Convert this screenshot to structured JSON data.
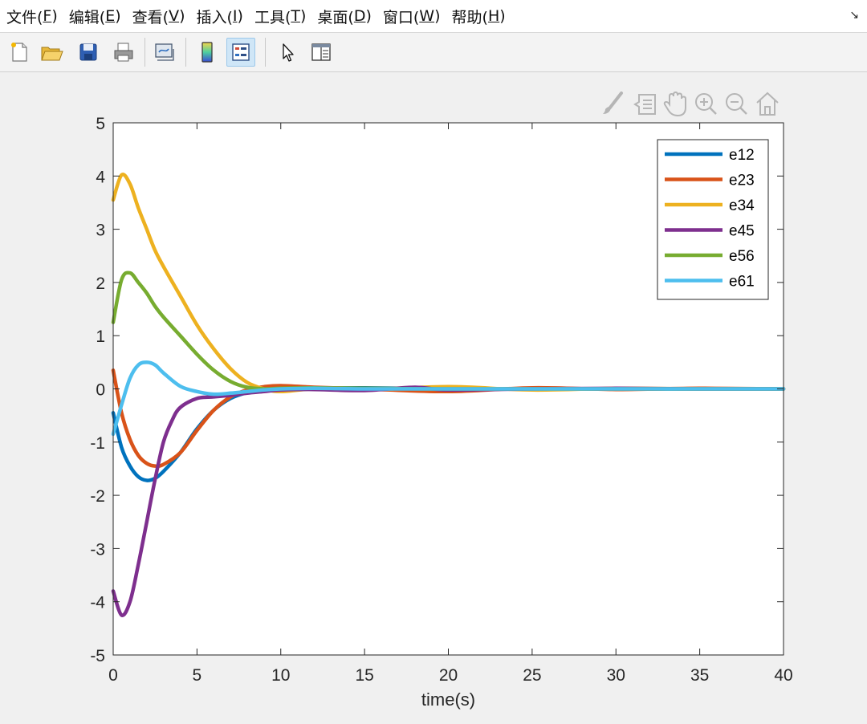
{
  "menubar": {
    "items": [
      {
        "text": "文件(",
        "mnemonic": "F",
        "close": ")"
      },
      {
        "text": "编辑(",
        "mnemonic": "E",
        "close": ")"
      },
      {
        "text": "查看(",
        "mnemonic": "V",
        "close": ")"
      },
      {
        "text": "插入(",
        "mnemonic": "I",
        "close": ")"
      },
      {
        "text": "工具(",
        "mnemonic": "T",
        "close": ")"
      },
      {
        "text": "桌面(",
        "mnemonic": "D",
        "close": ")"
      },
      {
        "text": "窗口(",
        "mnemonic": "W",
        "close": ")"
      },
      {
        "text": "帮助(",
        "mnemonic": "H",
        "close": ")"
      }
    ],
    "overflow_icon": "dock-arrow-icon"
  },
  "toolbar": {
    "buttons": [
      {
        "name": "new-figure-icon"
      },
      {
        "name": "open-file-icon"
      },
      {
        "name": "save-icon"
      },
      {
        "name": "print-icon"
      },
      {
        "name": "link-plot-icon"
      },
      {
        "name": "insert-colorbar-icon"
      },
      {
        "name": "insert-legend-icon",
        "active": true
      },
      {
        "name": "edit-plot-icon"
      },
      {
        "name": "property-inspector-icon"
      }
    ]
  },
  "axes_toolbar": {
    "icons": [
      "brush-icon",
      "data-tips-icon",
      "pan-icon",
      "zoom-in-icon",
      "zoom-out-icon",
      "restore-view-icon"
    ]
  },
  "colors": {
    "e12": "#0072BD",
    "e23": "#D95319",
    "e34": "#EDB120",
    "e45": "#7E2F8E",
    "e56": "#77AC30",
    "e61": "#4DBEEE"
  },
  "chart_data": {
    "type": "line",
    "title": "",
    "xlabel": "time(s)",
    "ylabel": "",
    "xlim": [
      0,
      40
    ],
    "ylim": [
      -5,
      5
    ],
    "xticks": [
      0,
      5,
      10,
      15,
      20,
      25,
      30,
      35,
      40
    ],
    "yticks": [
      5,
      4,
      3,
      2,
      1,
      0,
      -1,
      -2,
      -3,
      -4,
      -5
    ],
    "grid": false,
    "legend_position": "top-right",
    "series": [
      {
        "name": "e12",
        "color": "#0072BD",
        "x": [
          0,
          0.5,
          1,
          1.5,
          2,
          2.5,
          3,
          4,
          5,
          6,
          7,
          8,
          9,
          10,
          12,
          15,
          20,
          25,
          30,
          35,
          40
        ],
        "y": [
          -0.45,
          -1.1,
          -1.45,
          -1.65,
          -1.72,
          -1.68,
          -1.55,
          -1.2,
          -0.75,
          -0.4,
          -0.18,
          -0.07,
          -0.02,
          0.0,
          0.01,
          0.02,
          0.0,
          0.0,
          0.0,
          0.0,
          0.0
        ]
      },
      {
        "name": "e23",
        "color": "#D95319",
        "x": [
          0,
          0.5,
          1,
          1.5,
          2,
          2.5,
          3,
          4,
          5,
          6,
          7,
          8,
          9,
          10,
          12,
          15,
          20,
          25,
          30,
          35,
          40
        ],
        "y": [
          0.35,
          -0.45,
          -0.95,
          -1.25,
          -1.4,
          -1.45,
          -1.42,
          -1.2,
          -0.78,
          -0.4,
          -0.15,
          -0.02,
          0.04,
          0.06,
          0.03,
          0.0,
          -0.05,
          0.02,
          -0.01,
          0.01,
          0.0
        ]
      },
      {
        "name": "e34",
        "color": "#EDB120",
        "x": [
          0,
          0.5,
          1,
          1.5,
          2,
          2.5,
          3,
          4,
          5,
          6,
          7,
          8,
          9,
          10,
          12,
          15,
          20,
          25,
          30,
          35,
          40
        ],
        "y": [
          3.55,
          4.02,
          3.85,
          3.4,
          3.0,
          2.6,
          2.3,
          1.75,
          1.2,
          0.75,
          0.38,
          0.12,
          0.0,
          -0.05,
          0.0,
          -0.02,
          0.04,
          -0.02,
          0.01,
          0.0,
          0.0
        ]
      },
      {
        "name": "e45",
        "color": "#7E2F8E",
        "x": [
          0,
          0.5,
          1,
          1.5,
          2,
          2.5,
          3,
          3.5,
          4,
          5,
          6,
          7,
          8,
          9,
          10,
          12,
          15,
          18,
          20,
          25,
          30,
          35,
          40
        ],
        "y": [
          -3.8,
          -4.25,
          -4.0,
          -3.3,
          -2.5,
          -1.7,
          -1.0,
          -0.6,
          -0.35,
          -0.18,
          -0.15,
          -0.12,
          -0.08,
          -0.05,
          -0.02,
          -0.01,
          -0.03,
          0.03,
          -0.02,
          0.0,
          0.01,
          0.0,
          0.0
        ]
      },
      {
        "name": "e56",
        "color": "#77AC30",
        "x": [
          0,
          0.5,
          1,
          1.5,
          2,
          2.5,
          3,
          4,
          5,
          6,
          7,
          8,
          9,
          10,
          12,
          15,
          20,
          25,
          30,
          35,
          40
        ],
        "y": [
          1.25,
          2.05,
          2.18,
          2.0,
          1.8,
          1.55,
          1.35,
          1.0,
          0.65,
          0.35,
          0.14,
          0.03,
          0.0,
          0.01,
          0.02,
          0.01,
          0.0,
          0.0,
          0.0,
          0.0,
          0.0
        ]
      },
      {
        "name": "e61",
        "color": "#4DBEEE",
        "x": [
          0,
          0.5,
          1,
          1.5,
          2,
          2.5,
          3,
          4,
          5,
          6,
          7,
          8,
          9,
          10,
          12,
          15,
          20,
          25,
          30,
          35,
          40
        ],
        "y": [
          -0.85,
          -0.3,
          0.2,
          0.45,
          0.5,
          0.45,
          0.3,
          0.05,
          -0.05,
          -0.1,
          -0.08,
          -0.05,
          -0.02,
          0.0,
          0.01,
          0.0,
          0.0,
          0.0,
          0.0,
          0.0,
          0.0
        ]
      }
    ]
  }
}
